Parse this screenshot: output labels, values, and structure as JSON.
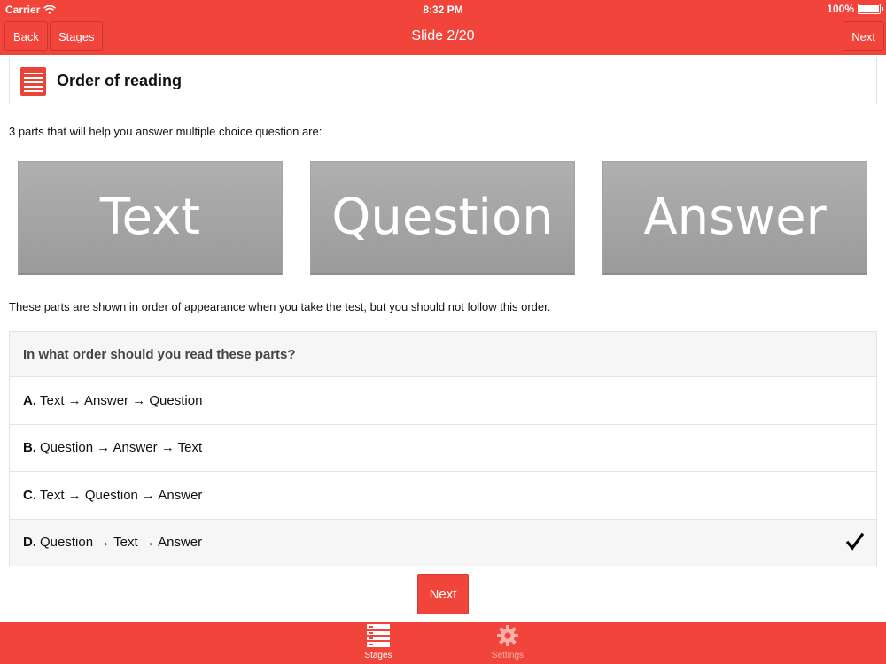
{
  "status": {
    "carrier": "Carrier",
    "time": "8:32 PM",
    "battery": "100%"
  },
  "nav": {
    "back_label": "Back",
    "stages_label": "Stages",
    "title": "Slide 2/20",
    "next_label": "Next"
  },
  "header": {
    "icon": "document-list-icon",
    "title": "Order of reading"
  },
  "intro_text": "3 parts that will help you answer multiple choice question are:",
  "tiles": [
    "Text",
    "Question",
    "Answer"
  ],
  "note_text": "These parts are shown in order of appearance when you take the test, but you should not follow this order.",
  "question": {
    "prompt": "In what order should you read these parts?",
    "options": [
      {
        "letter": "A.",
        "text": "Text →  Answer →  Question",
        "selected": false
      },
      {
        "letter": "B.",
        "text": "Question →  Answer →  Text",
        "selected": false
      },
      {
        "letter": "C.",
        "text": "Text →  Question →  Answer",
        "selected": false
      },
      {
        "letter": "D.",
        "text": "Question →  Text →  Answer",
        "selected": true
      }
    ]
  },
  "next_button_label": "Next",
  "tabbar": {
    "tabs": [
      {
        "label": "Stages",
        "icon": "stages-icon",
        "active": true
      },
      {
        "label": "Settings",
        "icon": "gear-icon",
        "active": false
      }
    ]
  },
  "colors": {
    "accent": "#f1453c",
    "tile_gray": "#a6a5a6"
  }
}
